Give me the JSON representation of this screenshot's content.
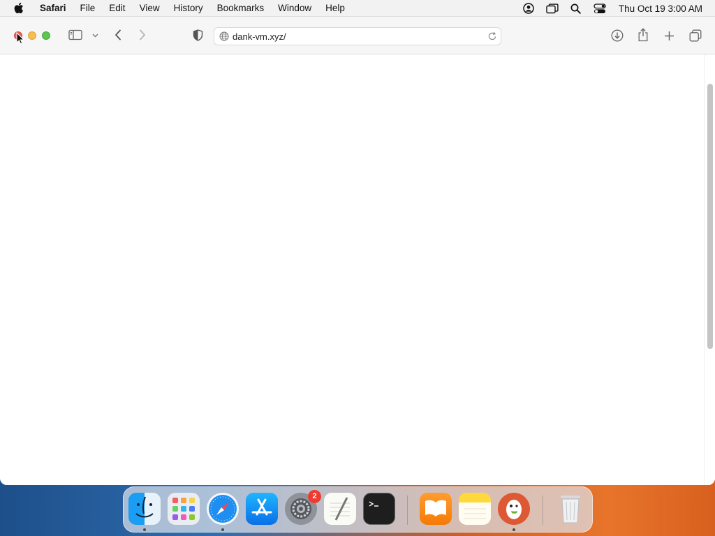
{
  "menubar": {
    "app_name": "Safari",
    "items": [
      "File",
      "Edit",
      "View",
      "History",
      "Bookmarks",
      "Window",
      "Help"
    ],
    "clock": "Thu Oct 19  3:00 AM",
    "status_icons": [
      "user-account-icon",
      "screen-mirroring-icon",
      "spotlight-search-icon",
      "control-center-icon"
    ]
  },
  "toolbar": {
    "address": "dank-vm.xyz/",
    "icons": [
      "sidebar-icon",
      "chevron-down-icon",
      "back-icon",
      "forward-icon",
      "privacy-shield-icon",
      "globe-icon",
      "reload-icon",
      "download-icon",
      "share-icon",
      "new-tab-icon",
      "tab-overview-icon"
    ]
  },
  "dock": {
    "apps": [
      {
        "name": "Finder",
        "icon": "finder-icon",
        "running": true
      },
      {
        "name": "Launchpad",
        "icon": "launchpad-icon",
        "running": false
      },
      {
        "name": "Safari",
        "icon": "safari-icon",
        "running": true
      },
      {
        "name": "App Store",
        "icon": "app-store-icon",
        "running": false
      },
      {
        "name": "System Settings",
        "icon": "system-settings-icon",
        "running": false,
        "badge": "2"
      },
      {
        "name": "TextEdit",
        "icon": "textedit-icon",
        "running": false
      },
      {
        "name": "Terminal",
        "icon": "terminal-icon",
        "running": false
      },
      {
        "name": "Books",
        "icon": "books-icon",
        "running": false
      },
      {
        "name": "Notes",
        "icon": "notes-icon",
        "running": false
      },
      {
        "name": "DuckDuckGo",
        "icon": "duckduckgo-icon",
        "running": true
      },
      {
        "name": "Trash",
        "icon": "trash-icon",
        "running": false
      }
    ]
  },
  "colors": {
    "close": "#ec5f57",
    "minimize": "#f4bf4f",
    "maximize": "#5fc454",
    "badge": "#ee3b30"
  }
}
